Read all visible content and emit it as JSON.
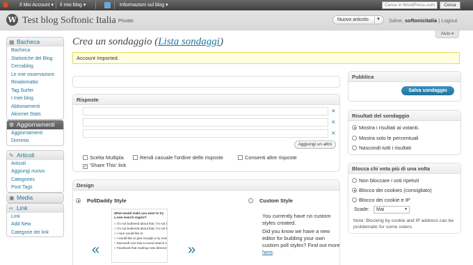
{
  "adminbar": {
    "account": "Il Mio Account",
    "my_blog": "Il mio blog",
    "info_blog": "Informazioni sul blog",
    "search_placeholder": "Cerca in WordPress.com",
    "search_button": "Cerca"
  },
  "header": {
    "site_title": "Test blog Softonic Italia",
    "private_label": "Privato",
    "new_article": "Nuovo articolo",
    "greeting_prefix": "Salve,",
    "username": "softonicitalia",
    "logout": "Logout",
    "help": "Aiuto"
  },
  "menu": {
    "bacheca": {
      "label": "Bacheca",
      "items": [
        "Bacheca",
        "Statistiche del Blog",
        "Cercablog",
        "Le mie osservazioni",
        "Readomattic",
        "Tag Surfer",
        "I miei blog",
        "Abbonamenti",
        "Akismet Stats"
      ]
    },
    "aggiornamenti": {
      "label": "Aggiornamenti",
      "items": [
        "Aggiornamenti",
        "Dominio"
      ]
    },
    "articoli": {
      "label": "Articoli",
      "items": [
        "Articoli",
        "Aggiungi nuovo",
        "Categories",
        "Post Tags"
      ]
    },
    "media": {
      "label": "Media"
    },
    "link": {
      "label": "Link",
      "items": [
        "Link",
        "Add New",
        "Categorie dei link"
      ]
    }
  },
  "page": {
    "title": "Crea un sondaggio (",
    "title_link": "Lista sondaggi",
    "title_end": ")",
    "notice": "Account Imported."
  },
  "risposte": {
    "heading": "Risposte",
    "add_button": "Aggiungi un altro",
    "options": [
      {
        "label": "Scelta Multipla",
        "checked": false
      },
      {
        "label": "Rendi casuale l'ordine delle risposte",
        "checked": false
      },
      {
        "label": "Consenti altre risposte",
        "checked": false
      },
      {
        "label": "'Share This' link",
        "checked": true
      }
    ]
  },
  "design": {
    "heading": "Design",
    "polldaddy_style": "PollDaddy Style",
    "custom_style": "Custom Style",
    "no_custom_text": "You currently have no custom styles created.",
    "new_editor_text": "Did you know we have a new editor for building your own custom poll styles? Find out more",
    "here_link": "here",
    "preview_question": "What would make you want to try a new search engine?",
    "preview_options": [
      "I'm not bothered about that. I'm not bothered about that. I'm not bothered",
      "I'm not bothered about that. I'm not bothered about that",
      "I sure would like to",
      "I would like to give Google a try now",
      "Microsoft Live has a sound search engine",
      "Facebook that mashup new directory"
    ]
  },
  "pubblica": {
    "heading": "Pubblica",
    "save_button": "Salva sondaggio"
  },
  "risultati": {
    "heading": "Risultati del sondaggio",
    "options": [
      {
        "label": "Mostra i risultati ai votanti.",
        "selected": true
      },
      {
        "label": "Mostra solo le percentuali",
        "selected": false
      },
      {
        "label": "Nascondi tutti i risultati",
        "selected": false
      }
    ]
  },
  "blocca": {
    "heading": "Blocca chi vota più di una volta",
    "options": [
      {
        "label": "Non bloccare i voti ripetuti",
        "selected": false
      },
      {
        "label": "Blocco dei cookies (consigliato)",
        "selected": true
      },
      {
        "label": "Blocco dei cookie e IP",
        "selected": false
      }
    ],
    "expire_label": "Scade:",
    "expire_value": "Mai",
    "note": "Note: Blocking by cookie and IP address can be problematic for some voters."
  }
}
